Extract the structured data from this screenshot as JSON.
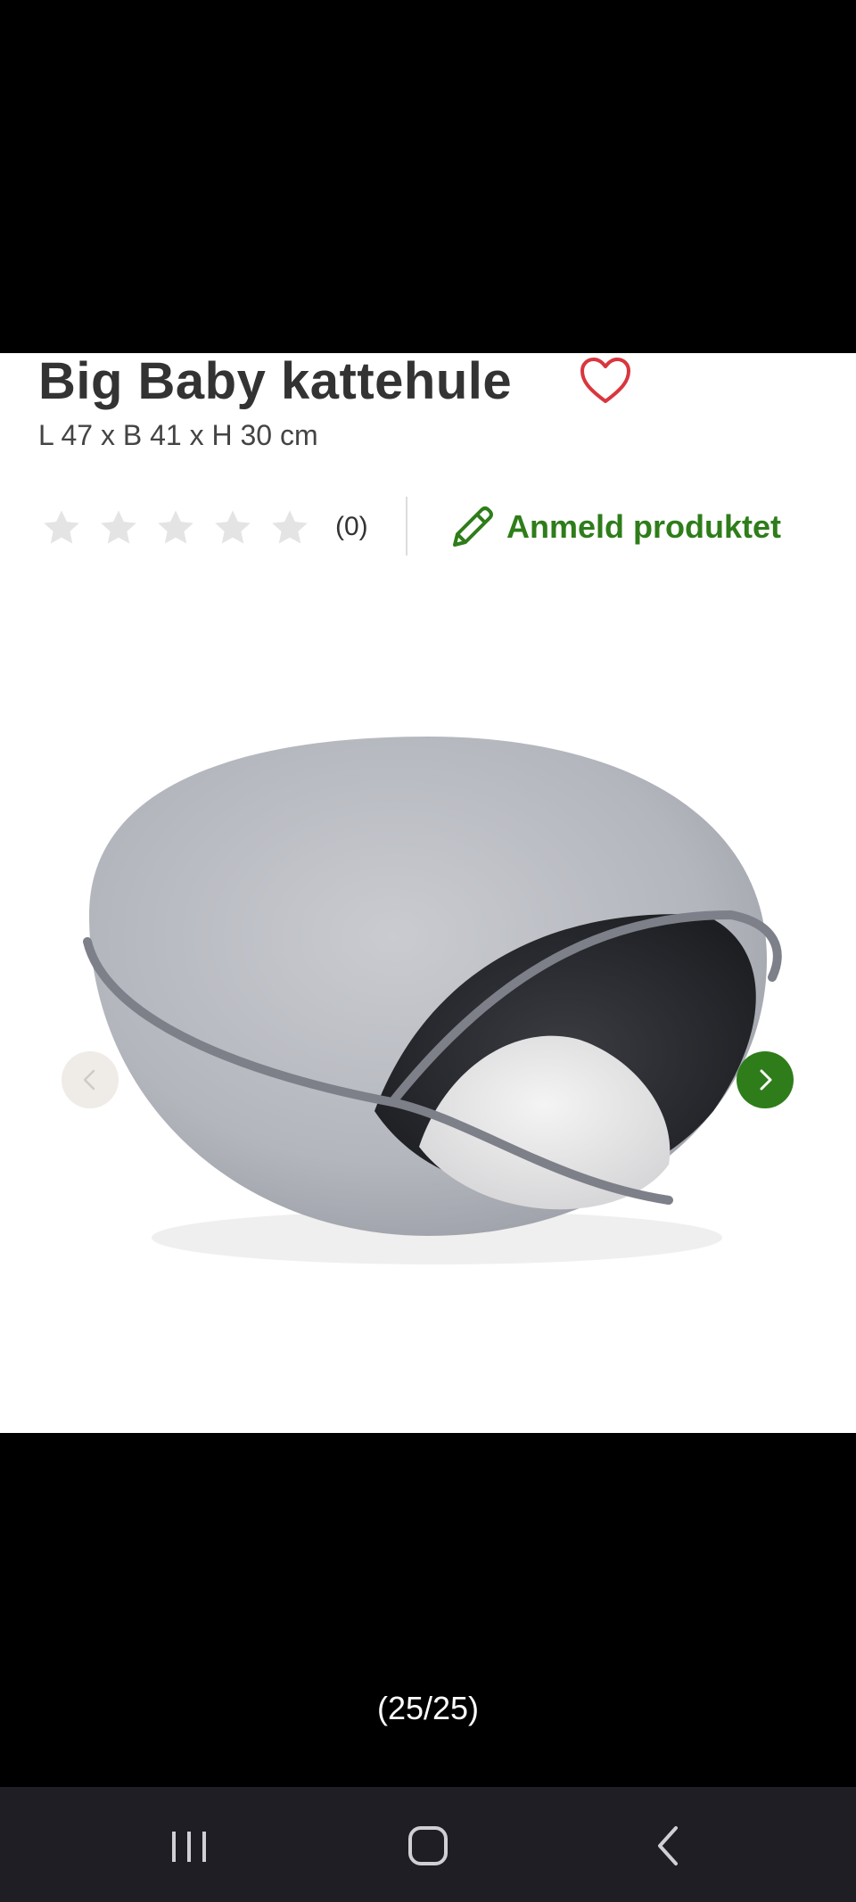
{
  "product": {
    "title": "Big Baby kattehule",
    "dimensions": "L 47 x B 41 x H 30 cm",
    "rating_count": "(0)",
    "rating_value": 0,
    "rating_max": 5,
    "review_label": "Anmeld produktet"
  },
  "gallery": {
    "counter": "(25/25)"
  },
  "icons": {
    "favorite": "heart-outline-icon",
    "review": "pencil-icon",
    "prev": "chevron-left-icon",
    "next": "chevron-right-icon"
  },
  "colors": {
    "accent_green": "#2e7d1a",
    "heart_red": "#d9363e",
    "star_gray": "#e4e4e4",
    "nav_bar": "#1e1e24"
  },
  "system_nav": {
    "recent": "recent-apps-icon",
    "home": "home-icon",
    "back": "back-icon"
  }
}
